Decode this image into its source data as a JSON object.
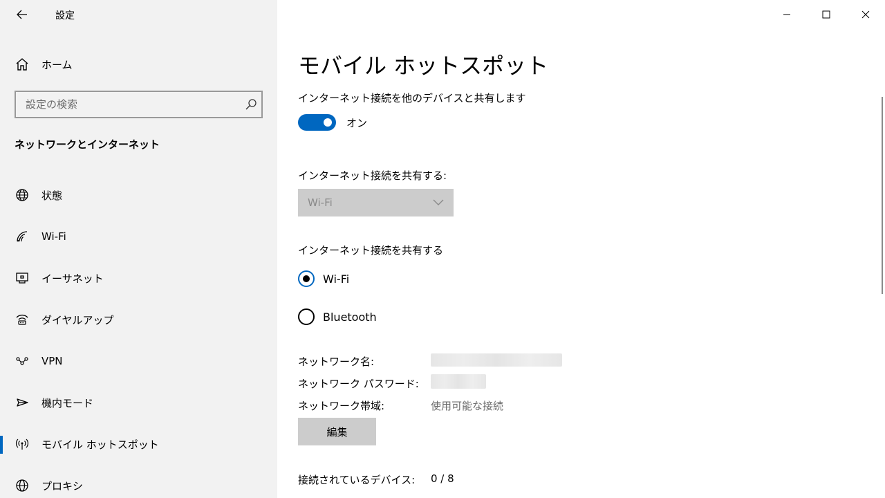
{
  "window": {
    "app_title": "設定"
  },
  "sidebar": {
    "home_label": "ホーム",
    "search_placeholder": "設定の検索",
    "section_heading": "ネットワークとインターネット",
    "items": [
      {
        "label": "状態",
        "icon": "globe-status-icon"
      },
      {
        "label": "Wi-Fi",
        "icon": "wifi-icon"
      },
      {
        "label": "イーサネット",
        "icon": "ethernet-icon"
      },
      {
        "label": "ダイヤルアップ",
        "icon": "dialup-icon"
      },
      {
        "label": "VPN",
        "icon": "vpn-icon"
      },
      {
        "label": "機内モード",
        "icon": "airplane-icon"
      },
      {
        "label": "モバイル ホットスポット",
        "icon": "hotspot-icon",
        "selected": true
      },
      {
        "label": "プロキシ",
        "icon": "globe-proxy-icon"
      }
    ]
  },
  "main": {
    "title": "モバイル ホットスポット",
    "share_description": "インターネット接続を他のデバイスと共有します",
    "toggle_state": "オン",
    "share_from_label": "インターネット接続を共有する:",
    "share_from_value": "Wi-Fi",
    "share_over_label": "インターネット接続を共有する",
    "share_over_options": [
      {
        "label": "Wi-Fi",
        "checked": true
      },
      {
        "label": "Bluetooth",
        "checked": false
      }
    ],
    "network_name_label": "ネットワーク名:",
    "network_password_label": "ネットワーク パスワード:",
    "network_band_label": "ネットワーク帯域:",
    "network_band_value": "使用可能な接続",
    "edit_label": "編集",
    "connected_devices_label": "接続されているデバイス:",
    "connected_devices_value": "0 / 8"
  },
  "colors": {
    "accent": "#0067c0",
    "sidebar_bg": "#f2f2f2",
    "disabled_bg": "#cccccc"
  }
}
